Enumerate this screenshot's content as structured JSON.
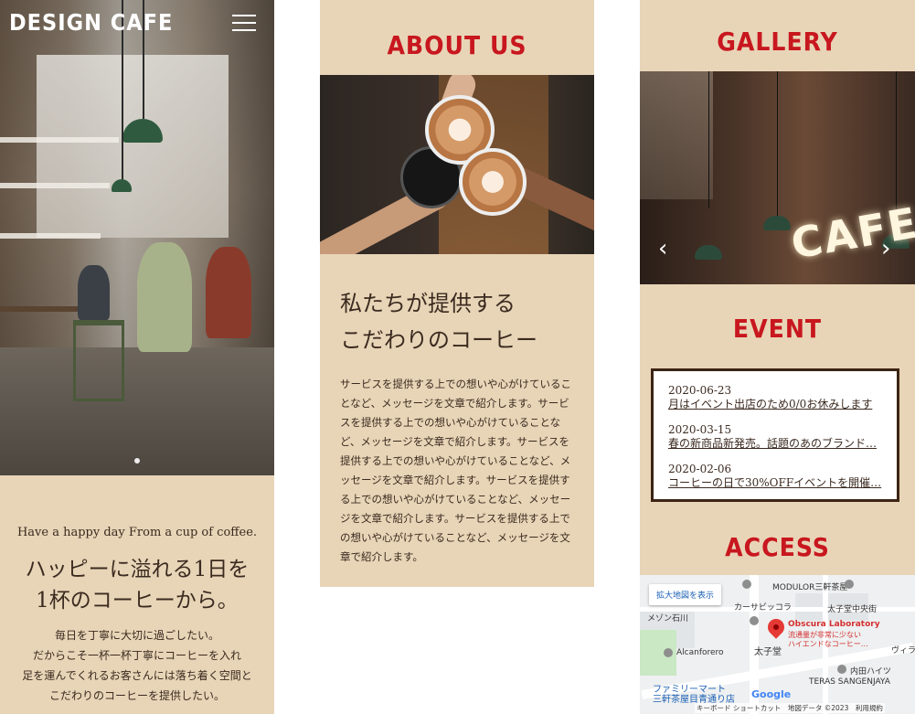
{
  "hero": {
    "brand": "DESIGN CAFE",
    "tagline": "Have a happy day From a cup of coffee.",
    "heading_line1": "ハッピーに溢れる1日を",
    "heading_line2": "1杯のコーヒーから。",
    "body_line1": "毎日を丁寧に大切に過ごしたい。",
    "body_line2": "だからこそ一杯一杯丁寧にコーヒーを入れ",
    "body_line3": "足を運んでくれるお客さんには落ち着く空間と",
    "body_line4": "こだわりのコーヒーを提供したい。"
  },
  "about": {
    "title": "ABOUT US",
    "heading_line1": "私たちが提供する",
    "heading_line2": "こだわりのコーヒー",
    "body": "サービスを提供する上での想いや心がけていることなど、メッセージを文章で紹介します。サービスを提供する上での想いや心がけていることなど、メッセージを文章で紹介します。サービスを提供する上での想いや心がけていることなど、メッセージを文章で紹介します。サービスを提供する上での想いや心がけていることなど、メッセージを文章で紹介します。サービスを提供する上での想いや心がけていることなど、メッセージを文章で紹介します。"
  },
  "gallery": {
    "title": "GALLERY",
    "sign_text": "CAFE",
    "prev_arrow": "‹",
    "next_arrow": "›"
  },
  "event": {
    "title": "EVENT",
    "items": [
      {
        "date": "2020-06-23",
        "title": "月はイベント出店のため0/0お休みします"
      },
      {
        "date": "2020-03-15",
        "title": "春の新商品新発売。話題のあのブランド…"
      },
      {
        "date": "2020-02-06",
        "title": "コーヒーの日で30%OFFイベントを開催…"
      }
    ]
  },
  "access": {
    "title": "ACCESS",
    "map": {
      "enlarge_button": "拡大地図を表示",
      "label_modulor": "MODULOR三軒茶屋",
      "label_kasa": "カーサビッコラ",
      "label_taishido_chuogai": "太子堂中央街",
      "label_mezon": "メゾン石川",
      "label_obscura": "Obscura Laboratory",
      "label_obscura_desc1": "流通量が非常に少ない",
      "label_obscura_desc2": "ハイエンドなコーヒー…",
      "label_alcanforero": "Alcanforero",
      "label_taishido": "太子堂",
      "label_uchida": "内田ハイツ",
      "label_villa": "ヴィラ",
      "label_teras": "TERAS SANGENJAYA",
      "label_familymart1": "ファミリーマート",
      "label_familymart2": "三軒茶屋目青通り店",
      "google": "Google",
      "footer": "キーボード ショートカット　地図データ ©2023　利用規約"
    }
  },
  "colors": {
    "accent": "#c8171f",
    "beige": "#e8d5b7",
    "text": "#3b2a20"
  }
}
